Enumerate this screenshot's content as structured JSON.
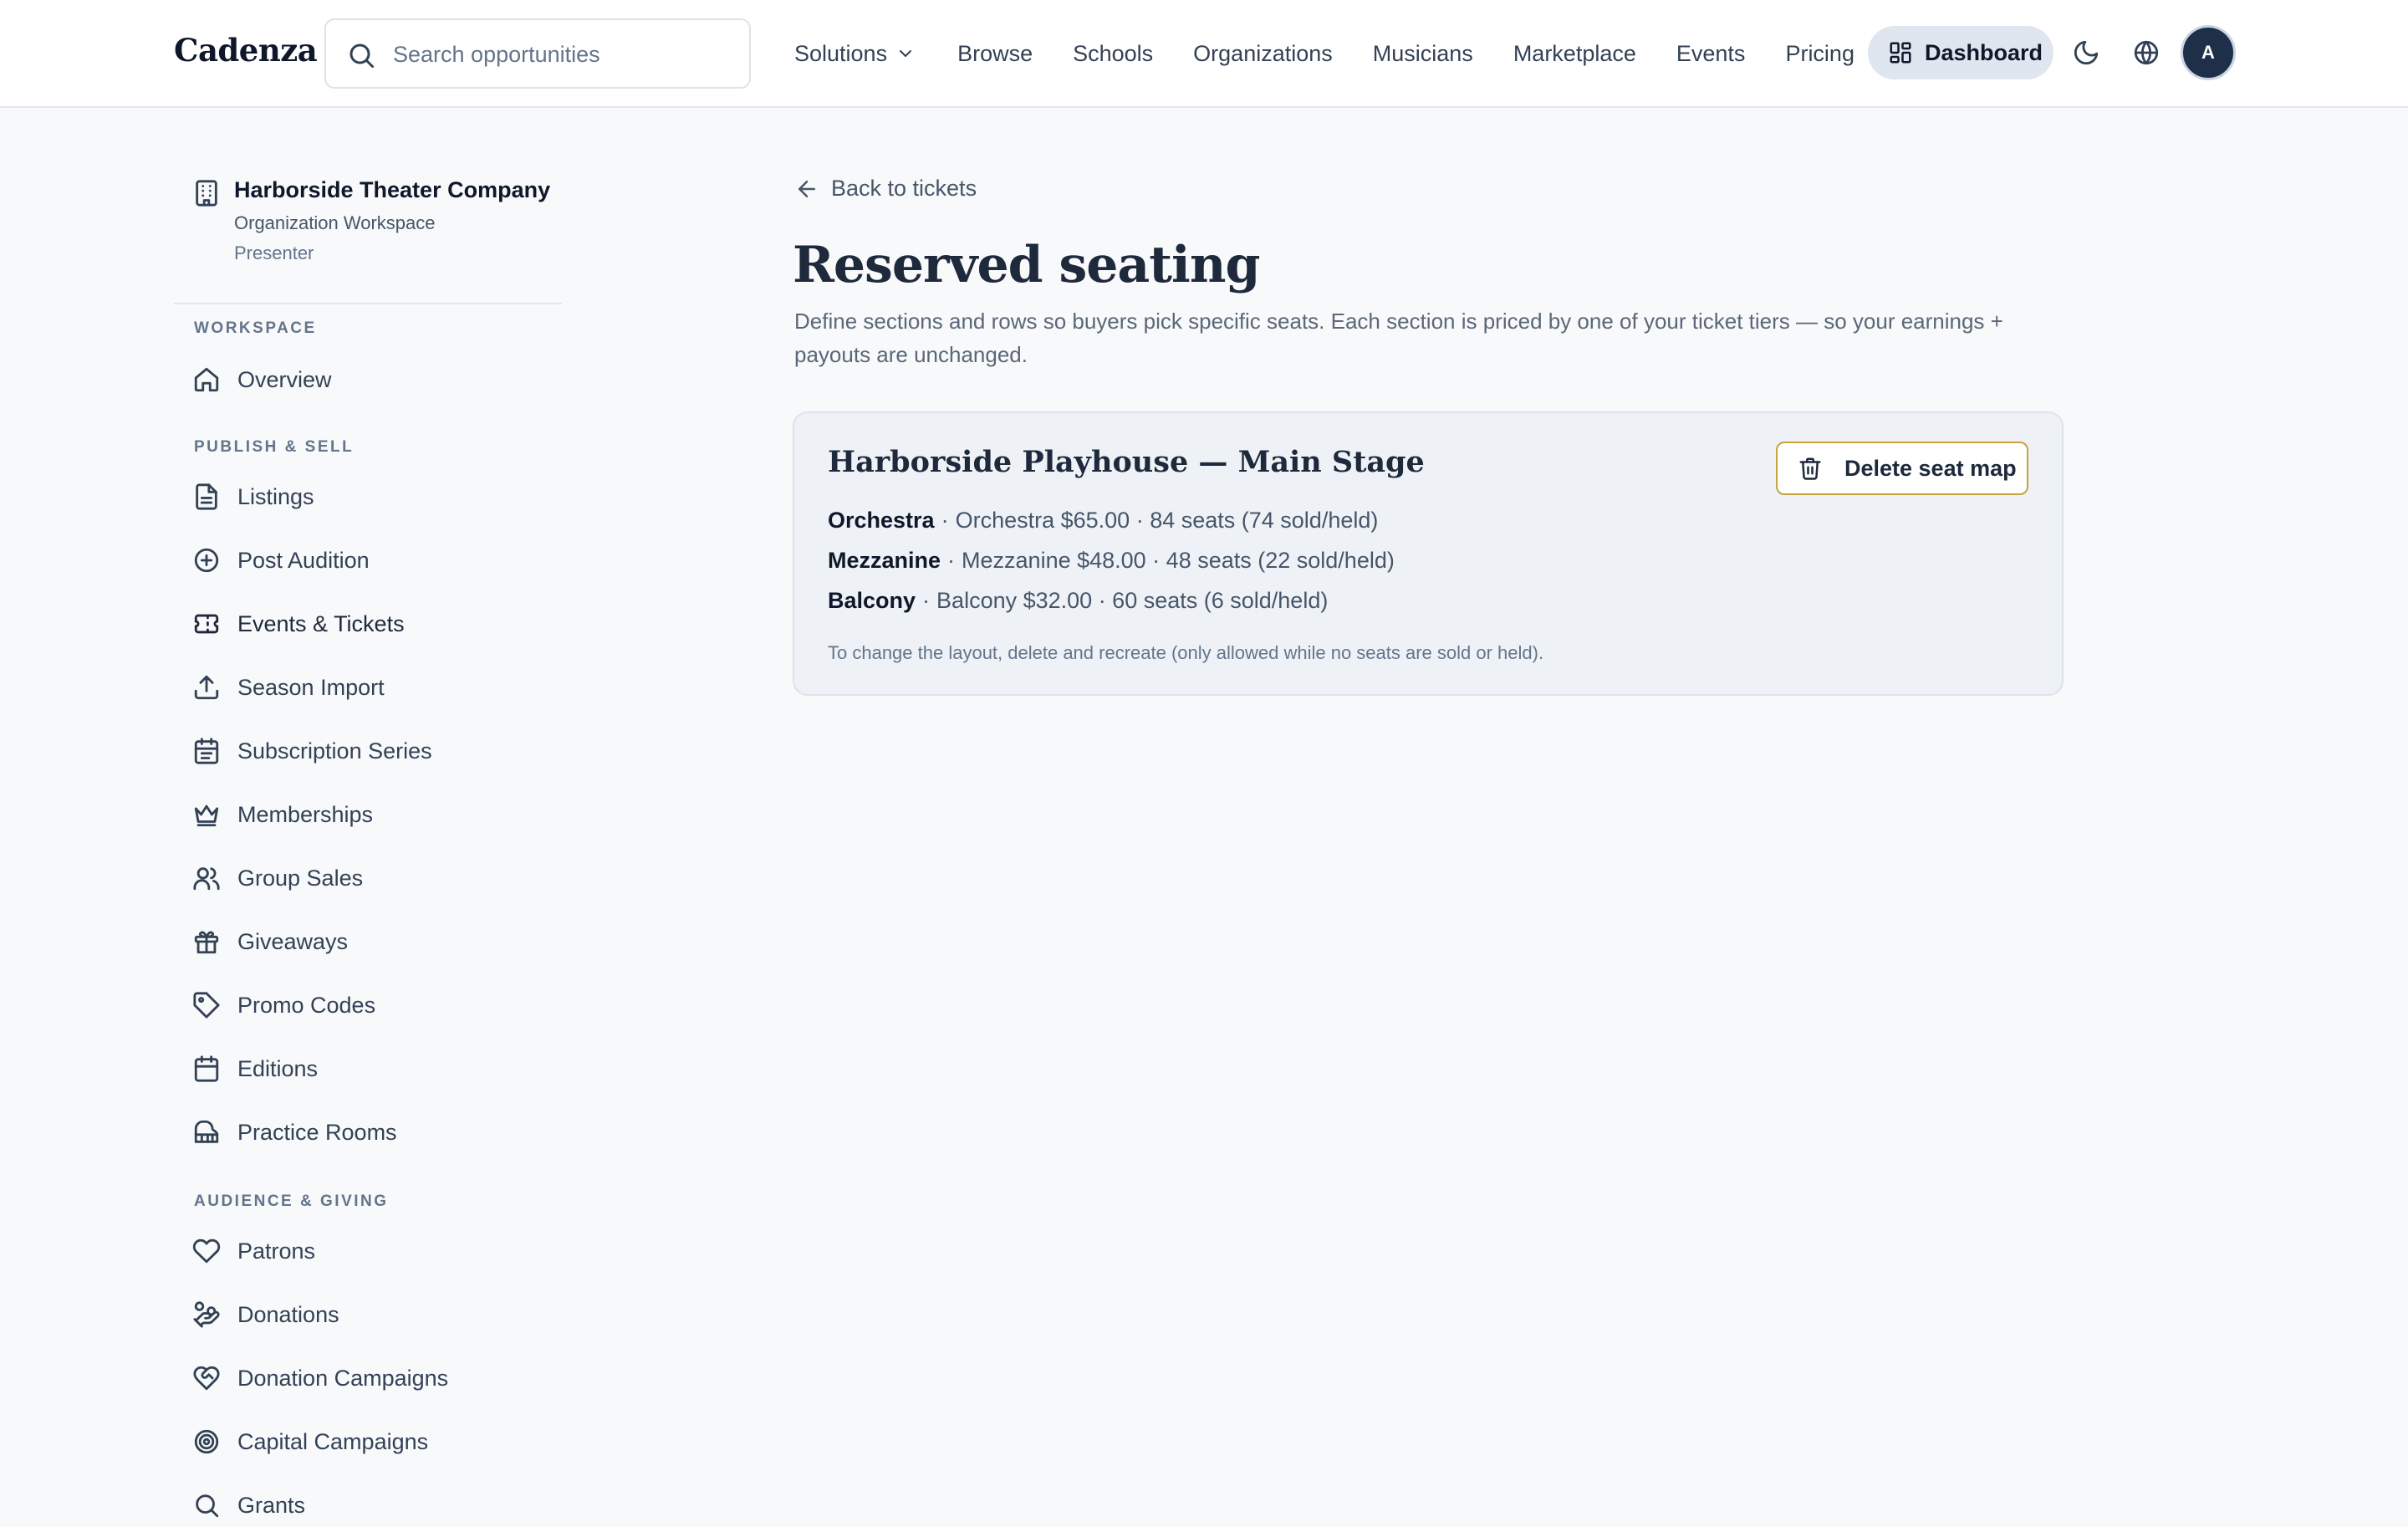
{
  "brand": "Cadenza",
  "search": {
    "placeholder": "Search opportunities"
  },
  "nav": {
    "items": [
      "Solutions",
      "Browse",
      "Schools",
      "Organizations",
      "Musicians",
      "Marketplace",
      "Events",
      "Pricing"
    ],
    "dashboard_label": "Dashboard",
    "avatar_initial": "A"
  },
  "org": {
    "name": "Harborside Theater Company",
    "type": "Organization Workspace",
    "role": "Presenter"
  },
  "sidebar": {
    "sections": [
      {
        "label": "Workspace",
        "items": [
          {
            "label": "Overview",
            "icon": "home-icon"
          }
        ]
      },
      {
        "label": "Publish & Sell",
        "items": [
          {
            "label": "Listings",
            "icon": "document-icon"
          },
          {
            "label": "Post Audition",
            "icon": "plus-circle-icon"
          },
          {
            "label": "Events & Tickets",
            "icon": "ticket-icon",
            "active": true
          },
          {
            "label": "Season Import",
            "icon": "upload-icon"
          },
          {
            "label": "Subscription Series",
            "icon": "calendar-list-icon"
          },
          {
            "label": "Memberships",
            "icon": "crown-icon"
          },
          {
            "label": "Group Sales",
            "icon": "users-icon"
          },
          {
            "label": "Giveaways",
            "icon": "gift-icon"
          },
          {
            "label": "Promo Codes",
            "icon": "tag-icon"
          },
          {
            "label": "Editions",
            "icon": "calendar-icon"
          },
          {
            "label": "Practice Rooms",
            "icon": "piano-icon"
          }
        ]
      },
      {
        "label": "Audience & Giving",
        "items": [
          {
            "label": "Patrons",
            "icon": "heart-icon"
          },
          {
            "label": "Donations",
            "icon": "hand-coins-icon"
          },
          {
            "label": "Donation Campaigns",
            "icon": "heart-handshake-icon"
          },
          {
            "label": "Capital Campaigns",
            "icon": "target-icon"
          },
          {
            "label": "Grants",
            "icon": "search-icon"
          }
        ]
      }
    ]
  },
  "main": {
    "back_label": "Back to tickets",
    "title": "Reserved seating",
    "description": "Define sections and rows so buyers pick specific seats. Each section is priced by one of your ticket tiers — so your earnings + payouts are unchanged.",
    "seat_map": {
      "title": "Harborside Playhouse — Main Stage",
      "delete_label": "Delete seat map",
      "sections": [
        {
          "name": "Orchestra",
          "detail": "Orchestra $65.00 · 84 seats (74 sold/held)"
        },
        {
          "name": "Mezzanine",
          "detail": "Mezzanine $48.00 · 48 seats (22 sold/held)"
        },
        {
          "name": "Balcony",
          "detail": "Balcony $32.00 · 60 seats (6 sold/held)"
        }
      ],
      "note": "To change the layout, delete and recreate (only allowed while no seats are sold or held)."
    }
  },
  "colors": {
    "accent_border": "#c9a23a",
    "avatar_bg": "#1e2f4a",
    "dashboard_bg": "#dfe6ef"
  }
}
